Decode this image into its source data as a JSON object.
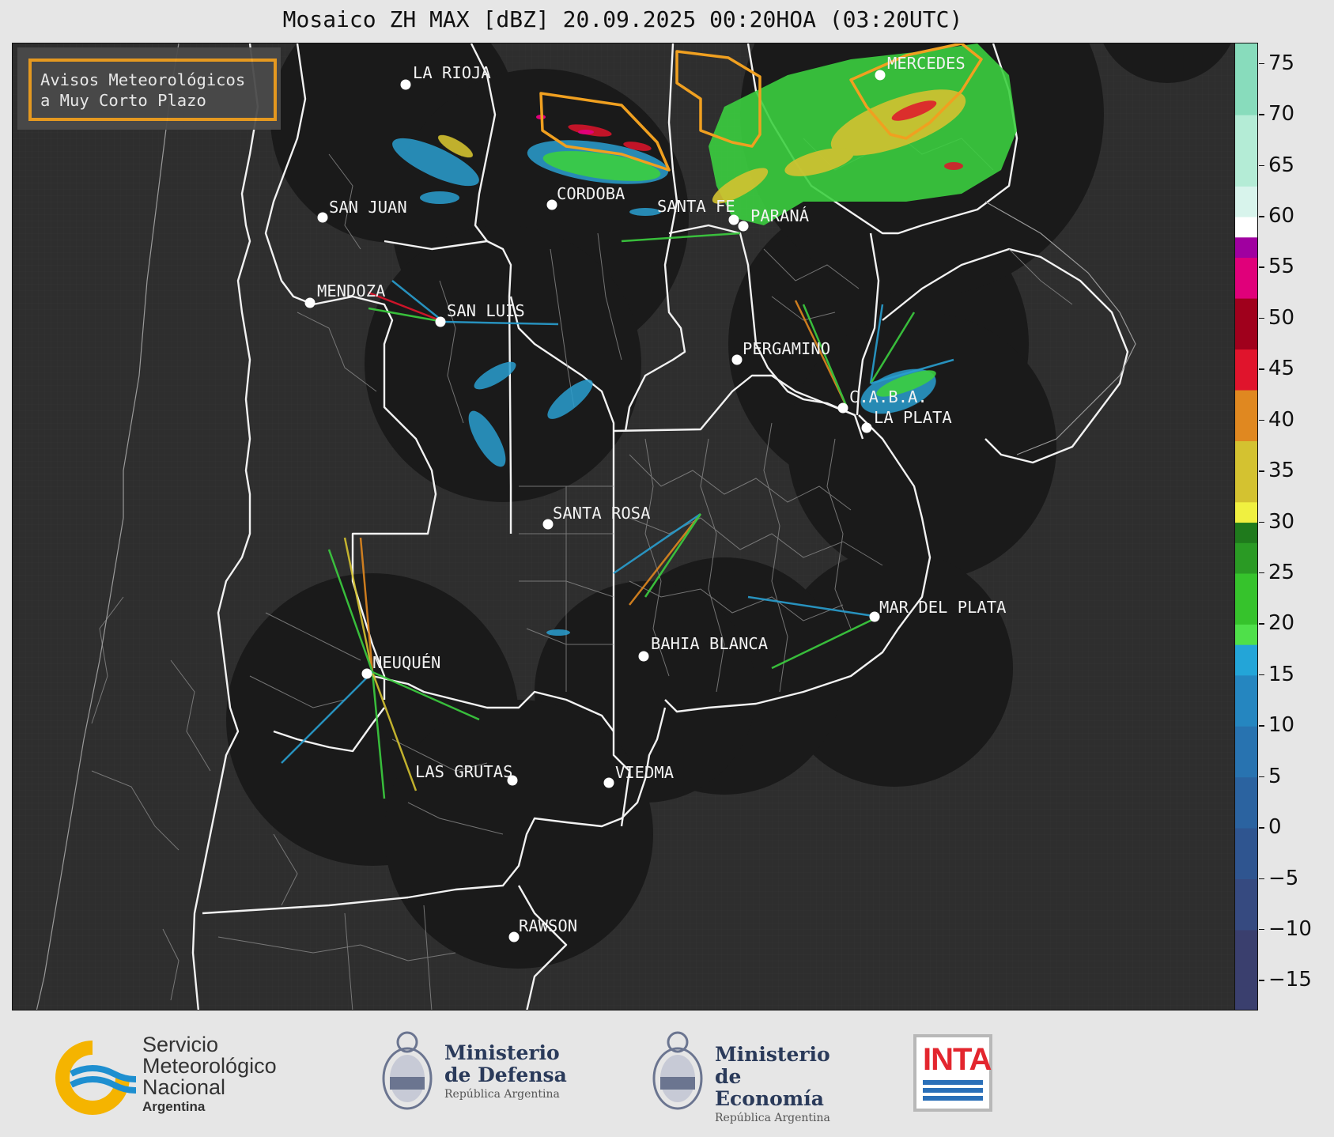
{
  "title": "Mosaico ZH MAX [dBZ] 20.09.2025 00:20HOA (03:20UTC)",
  "legend_box": {
    "line1": "Avisos Meteorológicos",
    "line2": "a Muy Corto Plazo",
    "border_color": "#f0a020"
  },
  "cities": [
    {
      "name": "LA RIOJA"
    },
    {
      "name": "SAN JUAN"
    },
    {
      "name": "CORDOBA"
    },
    {
      "name": "SANTA FE"
    },
    {
      "name": "PARANÁ"
    },
    {
      "name": "MERCEDES"
    },
    {
      "name": "MENDOZA"
    },
    {
      "name": "SAN LUIS"
    },
    {
      "name": "PERGAMINO"
    },
    {
      "name": "C.A.B.A."
    },
    {
      "name": "LA PLATA"
    },
    {
      "name": "SANTA ROSA"
    },
    {
      "name": "MAR DEL PLATA"
    },
    {
      "name": "BAHIA BLANCA"
    },
    {
      "name": "NEUQUÉN"
    },
    {
      "name": "LAS GRUTAS"
    },
    {
      "name": "VIEDMA"
    },
    {
      "name": "RAWSON"
    }
  ],
  "colorbar": {
    "unit": "dBZ",
    "min": -18,
    "max": 77,
    "ticks": [
      "75",
      "70",
      "65",
      "60",
      "55",
      "50",
      "45",
      "40",
      "35",
      "30",
      "25",
      "20",
      "15",
      "10",
      "5",
      "0",
      "−5",
      "−10",
      "−15"
    ],
    "tick_values": [
      75,
      70,
      65,
      60,
      55,
      50,
      45,
      40,
      35,
      30,
      25,
      20,
      15,
      10,
      5,
      0,
      -5,
      -10,
      -15
    ],
    "colors": [
      {
        "from": -18,
        "to": -10,
        "color": "#3a3f6e"
      },
      {
        "from": -10,
        "to": -5,
        "color": "#364a80"
      },
      {
        "from": -5,
        "to": 0,
        "color": "#2f5590"
      },
      {
        "from": 0,
        "to": 5,
        "color": "#2b63a0"
      },
      {
        "from": 5,
        "to": 10,
        "color": "#2873b0"
      },
      {
        "from": 10,
        "to": 15,
        "color": "#2586c0"
      },
      {
        "from": 15,
        "to": 18,
        "color": "#23a5d8"
      },
      {
        "from": 18,
        "to": 20,
        "color": "#4fe04a"
      },
      {
        "from": 20,
        "to": 25,
        "color": "#36c32c"
      },
      {
        "from": 25,
        "to": 28,
        "color": "#2a9a24"
      },
      {
        "from": 28,
        "to": 30,
        "color": "#1f7a1c"
      },
      {
        "from": 30,
        "to": 32,
        "color": "#f0f040"
      },
      {
        "from": 32,
        "to": 38,
        "color": "#d4c230"
      },
      {
        "from": 38,
        "to": 43,
        "color": "#e08820"
      },
      {
        "from": 43,
        "to": 47,
        "color": "#e0142c"
      },
      {
        "from": 47,
        "to": 52,
        "color": "#a0001c"
      },
      {
        "from": 52,
        "to": 56,
        "color": "#e0007a"
      },
      {
        "from": 56,
        "to": 58,
        "color": "#a000a0"
      },
      {
        "from": 58,
        "to": 60,
        "color": "#ffffff"
      },
      {
        "from": 60,
        "to": 63,
        "color": "#d8f4ec"
      },
      {
        "from": 63,
        "to": 70,
        "color": "#b4ecd6"
      },
      {
        "from": 70,
        "to": 77,
        "color": "#88dcbc"
      }
    ]
  },
  "footer": {
    "smn": {
      "line1": "Servicio",
      "line2": "Meteorológico",
      "line3": "Nacional",
      "country": "Argentina"
    },
    "defensa": {
      "line1": "Ministerio",
      "line2": "de Defensa",
      "line3": "República Argentina"
    },
    "economia": {
      "line1": "Ministerio",
      "line2": "de Economía",
      "line3": "República Argentina"
    },
    "inta": "INTA"
  }
}
